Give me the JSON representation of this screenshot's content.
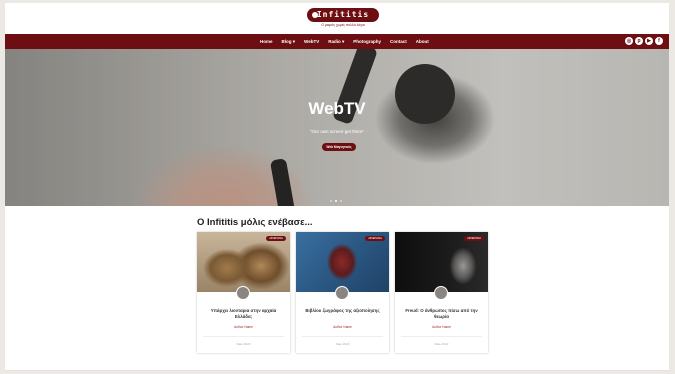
{
  "colors": {
    "brand": "#6d0f12",
    "nav_text": "#ffffff"
  },
  "header": {
    "logo_text": "Infititis",
    "logo_subtitle": "Ο μικρός χωρίς πολλά λόγια"
  },
  "nav": {
    "items": [
      {
        "label": "Home"
      },
      {
        "label": "Blog ▾"
      },
      {
        "label": "WebTV"
      },
      {
        "label": "Radio ▾"
      },
      {
        "label": "Photography"
      },
      {
        "label": "Contact"
      },
      {
        "label": "About"
      }
    ],
    "social_icons": [
      "instagram-icon",
      "pinterest-icon",
      "youtube-icon",
      "facebook-icon"
    ]
  },
  "hero": {
    "title": "WebTV",
    "quote": "\"Our own screen-get there\"",
    "button_label": "Web Μαγνητικός",
    "slide_count": 3,
    "active_slide": 2
  },
  "section": {
    "title": "Ο Infititis μόλις ενέβασε..."
  },
  "cards": [
    {
      "badge": "ΑΦΙΕΡΩΜΑ",
      "title": "Υπάρχει λιονταρια στην αρχαία Ελλάδα;",
      "author": "Author Name",
      "date": "Date 2023"
    },
    {
      "badge": "ΑΦΙΕΡΩΜΑ",
      "title": "Βιβλίου ζωγράφος της αξιοποίησης",
      "author": "Author Name",
      "date": "Date 2023"
    },
    {
      "badge": "ΑΦΙΕΡΩΜΑ",
      "title": "Freud: Ο άνθρωπος πίσω από την θεωρία",
      "author": "Author Name",
      "date": "Date 2023"
    }
  ]
}
